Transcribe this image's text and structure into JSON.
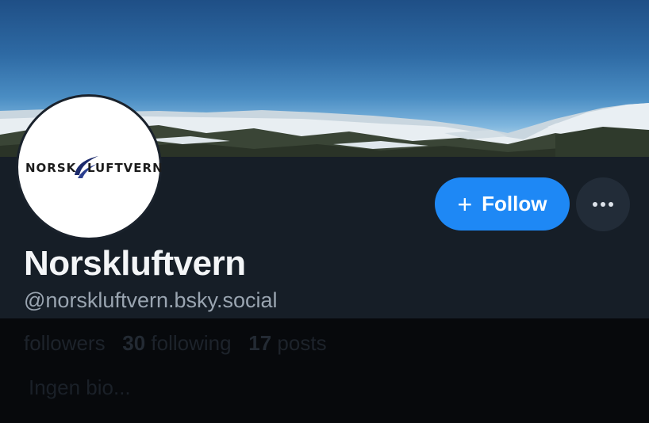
{
  "profile": {
    "display_name": "Norskluftvern",
    "handle": "@norskluftvern.bsky.social",
    "avatar": {
      "logo_left": "NORSK",
      "logo_right": "LUFTVERN"
    }
  },
  "actions": {
    "follow_label": "Follow",
    "follow_icon": "plus-icon",
    "more_icon": "ellipsis-icon"
  },
  "stats": {
    "followers_count": "",
    "followers_label": "followers",
    "following_count": "30",
    "following_label": "following",
    "posts_count": "17",
    "posts_label": "posts"
  },
  "bio": "Ingen bio...",
  "colors": {
    "background": "#161e27",
    "accent": "#1e88f5",
    "name_text": "#f3f5f7",
    "handle_text": "#9aa5b1"
  }
}
